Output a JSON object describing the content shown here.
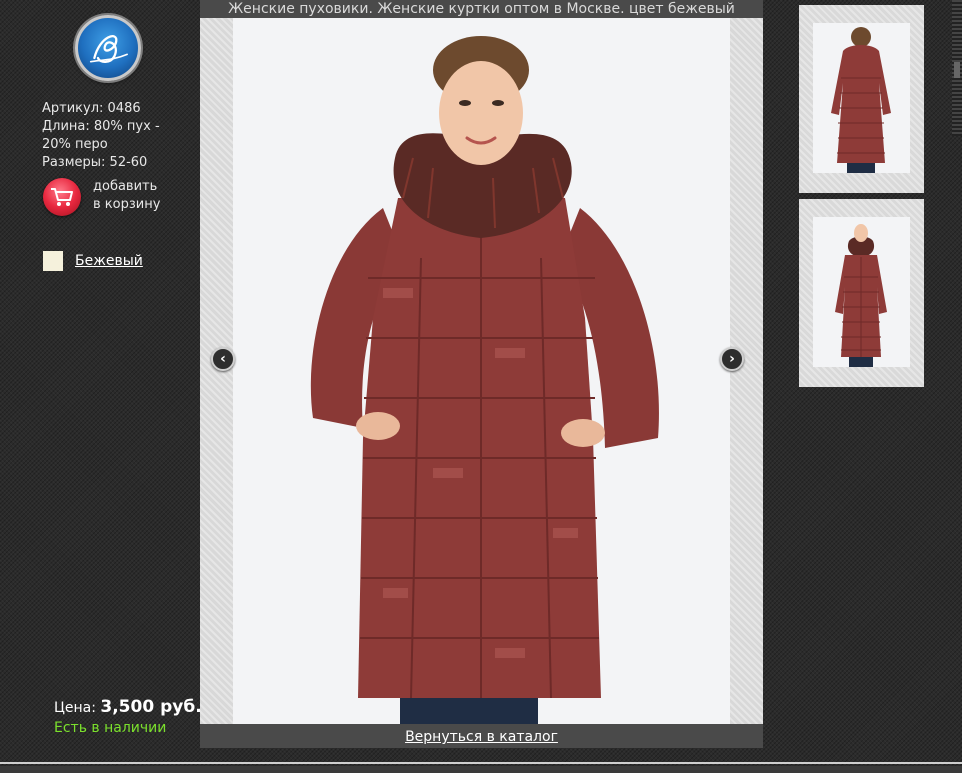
{
  "page": {
    "title": "Женские пуховики. Женские куртки оптом в Москве. цвет бежевый",
    "back_link": "Вернуться в каталог"
  },
  "logo": {
    "icon": "logo-emblem-icon"
  },
  "product": {
    "article": "Артикул: 0486",
    "length": "Длина: 80% пух - 20% перо",
    "sizes": "Размеры: 52-60",
    "add_to_cart_line1": "добавить",
    "add_to_cart_line2": "в корзину",
    "color_name": "Бежевый",
    "color_hex": "#f5f1dc",
    "price_label": "Цена:",
    "price_value": "3,500 руб.",
    "stock": "Есть в наличии",
    "stock_color": "#7be02c"
  },
  "viewer": {
    "prev_icon": "chevron-left-icon",
    "next_icon": "chevron-right-icon",
    "prev_glyph": "‹",
    "next_glyph": "›"
  },
  "thumbnails": [
    {
      "view": "back"
    },
    {
      "view": "front"
    }
  ],
  "colors": {
    "coat": "#8e3b38",
    "fur": "#5a2a25",
    "background": "#2b2b2b",
    "panel": "#4a4a4a"
  }
}
